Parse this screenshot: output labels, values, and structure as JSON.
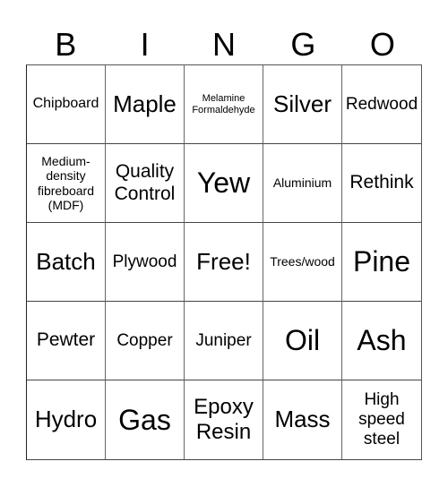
{
  "header": [
    "B",
    "I",
    "N",
    "G",
    "O"
  ],
  "cells": [
    {
      "text": "Chipboard",
      "size": "s-sm2"
    },
    {
      "text": "Maple",
      "size": "s-xl"
    },
    {
      "text": "Melamine Formaldehyde",
      "size": "s-xs"
    },
    {
      "text": "Silver",
      "size": "s-xl"
    },
    {
      "text": "Redwood",
      "size": "s-md"
    },
    {
      "text": "Medium-density fibreboard (MDF)",
      "size": "s-sm"
    },
    {
      "text": "Quality Control",
      "size": "s-lg"
    },
    {
      "text": "Yew",
      "size": "s-xxl"
    },
    {
      "text": "Aluminium",
      "size": "s-sm"
    },
    {
      "text": "Rethink",
      "size": "s-lg"
    },
    {
      "text": "Batch",
      "size": "s-xl"
    },
    {
      "text": "Plywood",
      "size": "s-md"
    },
    {
      "text": "Free!",
      "size": "s-xl"
    },
    {
      "text": "Trees/wood",
      "size": "s-sm"
    },
    {
      "text": "Pine",
      "size": "s-xxl"
    },
    {
      "text": "Pewter",
      "size": "s-lg"
    },
    {
      "text": "Copper",
      "size": "s-md"
    },
    {
      "text": "Juniper",
      "size": "s-md"
    },
    {
      "text": "Oil",
      "size": "s-xxl"
    },
    {
      "text": "Ash",
      "size": "s-xxl"
    },
    {
      "text": "Hydro",
      "size": "s-xl"
    },
    {
      "text": "Gas",
      "size": "s-xxl"
    },
    {
      "text": "Epoxy Resin",
      "size": "s-lg2"
    },
    {
      "text": "Mass",
      "size": "s-xl"
    },
    {
      "text": "High speed steel",
      "size": "s-md"
    }
  ]
}
